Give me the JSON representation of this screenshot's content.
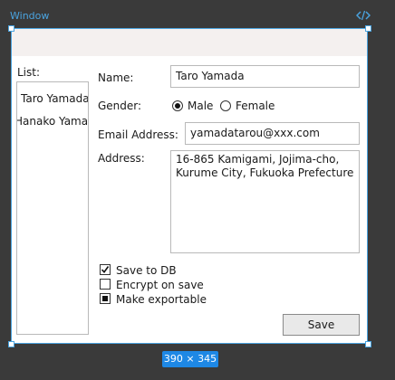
{
  "designer": {
    "window_label": "Window",
    "size_badge": "390 × 345"
  },
  "form": {
    "list_label": "List:",
    "list_items": [
      "Taro Yamada",
      "Hanako Yamada"
    ],
    "name_label": "Name:",
    "name_value": "Taro Yamada",
    "gender_label": "Gender:",
    "gender_options": [
      "Male",
      "Female"
    ],
    "gender_selected": "Male",
    "email_label": "Email Address:",
    "email_value": "yamadatarou@xxx.com",
    "address_label": "Address:",
    "address_lines": [
      "16-865 Kamigami, Jojima-cho,",
      "Kurume City, Fukuoka Prefecture"
    ],
    "checkboxes": [
      {
        "label": "Save to DB",
        "state": "checked"
      },
      {
        "label": "Encrypt on save",
        "state": "unchecked"
      },
      {
        "label": "Make exportable",
        "state": "indeterminate"
      }
    ],
    "save_label": "Save"
  },
  "colors": {
    "selection": "#4aa3df",
    "badge": "#1e88e5",
    "canvas": "#3a3a3a"
  },
  "icons": {
    "code": "code-icon"
  }
}
